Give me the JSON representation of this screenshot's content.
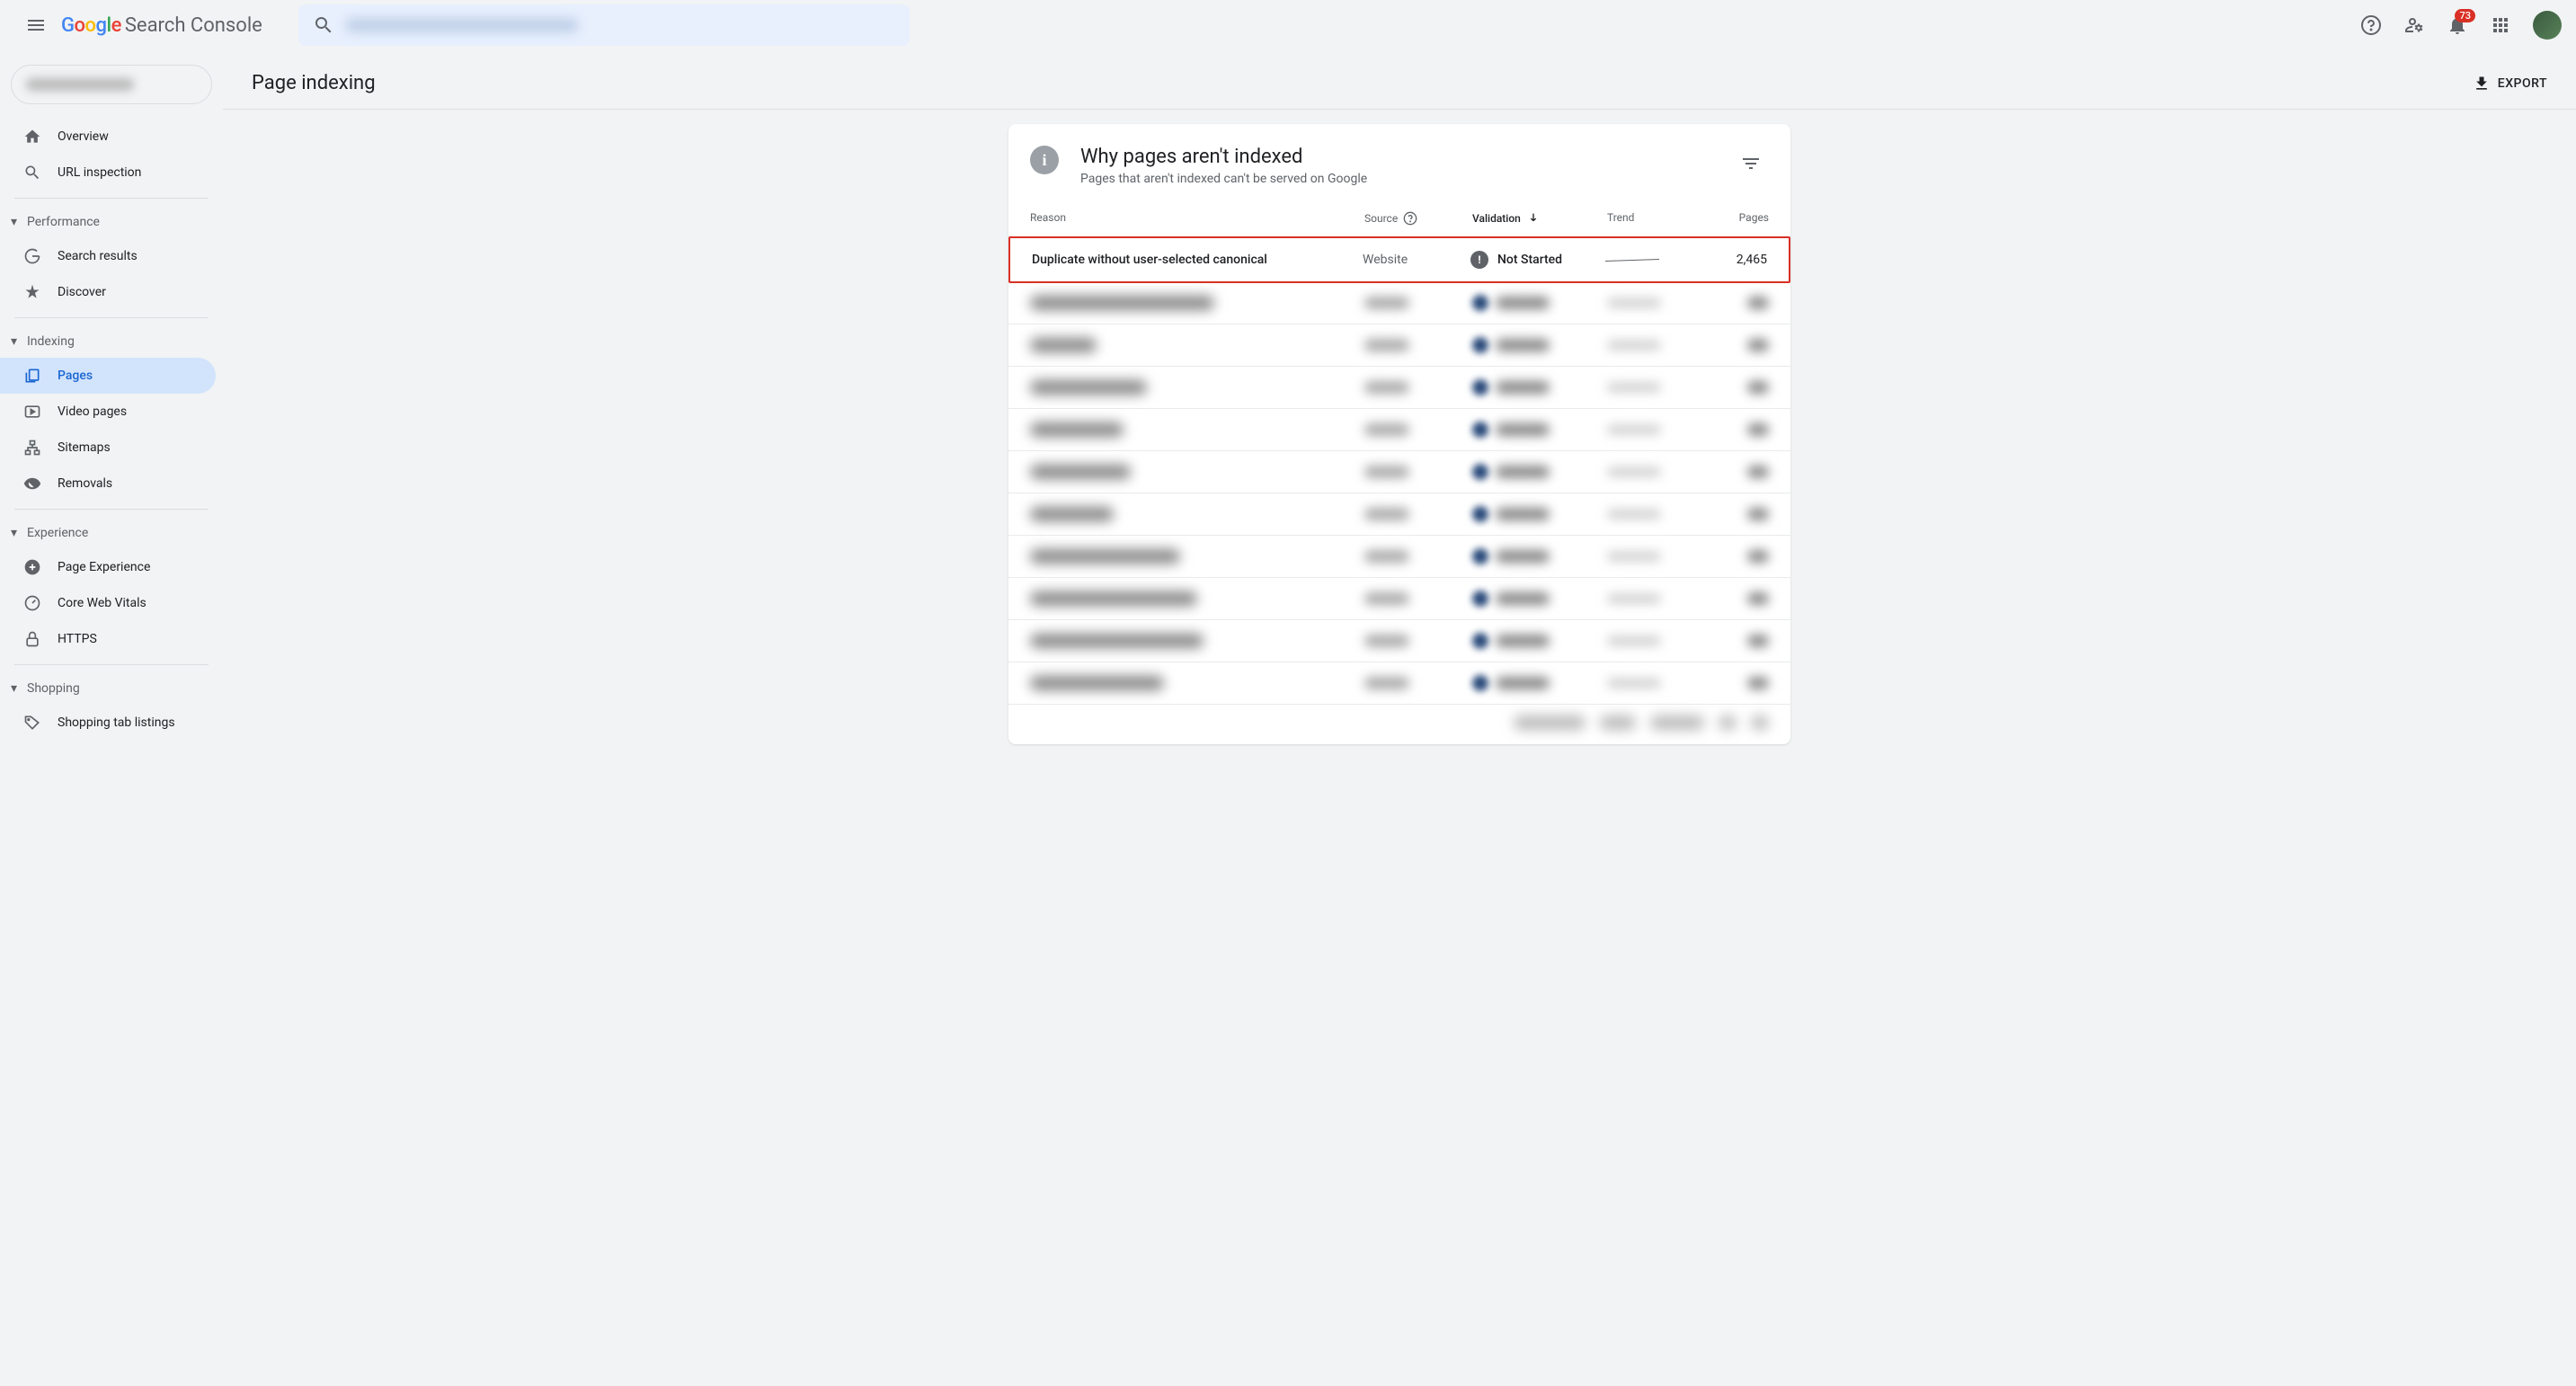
{
  "header": {
    "product_name_part1": "Google",
    "product_name_part2": "Search Console",
    "notification_count": "73"
  },
  "sidebar": {
    "items_top": [
      {
        "icon": "home",
        "label": "Overview"
      },
      {
        "icon": "search",
        "label": "URL inspection"
      }
    ],
    "sections": [
      {
        "title": "Performance",
        "items": [
          {
            "icon": "g",
            "label": "Search results"
          },
          {
            "icon": "discover",
            "label": "Discover"
          }
        ]
      },
      {
        "title": "Indexing",
        "items": [
          {
            "icon": "pages",
            "label": "Pages",
            "active": true
          },
          {
            "icon": "video",
            "label": "Video pages"
          },
          {
            "icon": "sitemap",
            "label": "Sitemaps"
          },
          {
            "icon": "removal",
            "label": "Removals"
          }
        ]
      },
      {
        "title": "Experience",
        "items": [
          {
            "icon": "plus",
            "label": "Page Experience"
          },
          {
            "icon": "gauge",
            "label": "Core Web Vitals"
          },
          {
            "icon": "lock",
            "label": "HTTPS"
          }
        ]
      },
      {
        "title": "Shopping",
        "items": [
          {
            "icon": "tag",
            "label": "Shopping tab listings"
          }
        ]
      }
    ]
  },
  "page": {
    "title": "Page indexing",
    "export_label": "EXPORT"
  },
  "card": {
    "title": "Why pages aren't indexed",
    "subtitle": "Pages that aren't indexed can't be served on Google"
  },
  "table": {
    "columns": {
      "reason": "Reason",
      "source": "Source",
      "validation": "Validation",
      "trend": "Trend",
      "pages": "Pages"
    },
    "highlighted_row": {
      "reason": "Duplicate without user-selected canonical",
      "source": "Website",
      "validation": "Not Started",
      "pages": "2,465"
    },
    "blurred_row_count": 10
  }
}
